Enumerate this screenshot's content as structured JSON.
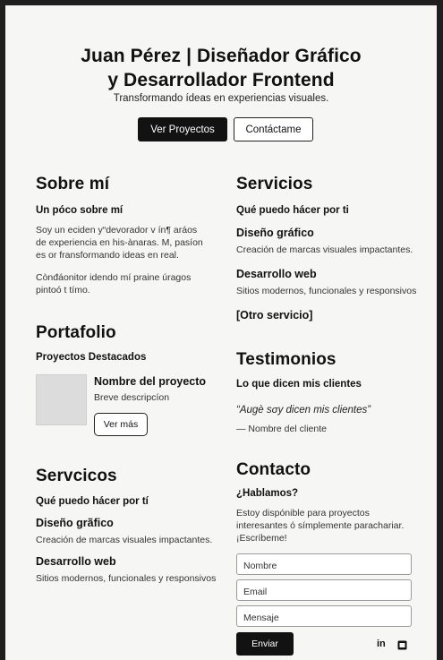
{
  "hero": {
    "title_line1": "Juan Pérez | Diseñador Gráfico",
    "title_line2": "y Desarrollador Frontend",
    "subtitle": "Transformando ídeas en experiencias visuales.",
    "primary_button": "Ver Proyectos",
    "secondary_button": "Contáctame"
  },
  "about": {
    "title": "Sobre mí",
    "subtitle": "Un póco sobre mí",
    "para1_line1": "Soy un eciden y“devorador v ín¶ aráos",
    "para1_line2": "de experiencia en his-ànaras. M, pasíon",
    "para1_line3": "es or fransformando ideas en real.",
    "para2_line1": "Cònđáonitor idendo mí praine úragos",
    "para2_line2": "pintoó t tímo."
  },
  "services_right": {
    "title": "Servicios",
    "subtitle": "Qué puedo hácer por ti",
    "items": [
      {
        "name": "Diseño gráfico",
        "desc": "Creación de marcas visuales impactantes."
      },
      {
        "name": "Desarrollo web",
        "desc": "Sitios modernos, funcionales y responsivos"
      },
      {
        "name": "[Otro servicio]",
        "desc": ""
      }
    ]
  },
  "portfolio": {
    "title": "Portafolio",
    "subtitle": "Proyectos Destacados",
    "project_name": "Nombre del proyecto",
    "project_desc": "Breve descripcíon",
    "button": "Ver más"
  },
  "testimonials": {
    "title": "Testimonios",
    "subtitle": "Lo que dicen mis clientes",
    "quote": "“Augè sσy dicen mis clientes”",
    "author": "— Nombre del cliente"
  },
  "services_left": {
    "title": "Servcicos",
    "subtitle": "Qué puedo hácer por tí",
    "items": [
      {
        "name": "Diseño grãfico",
        "desc": "Creación de marcas visuales impactantes."
      },
      {
        "name": "Desarrollo web",
        "desc": "Sitios modernos, funcionales y responsivos"
      }
    ]
  },
  "contact": {
    "title": "Contacto",
    "subtitle": "¿Hablamos?",
    "text_line1": "Estoy dispónible para proyectos",
    "text_line2": "interesantes ó símplemente parachariar.",
    "text_line3": "¡Escríbeme!",
    "name_placeholder": "Nombre",
    "email_placeholder": "Email",
    "message_placeholder": "Mensaje",
    "send_button": "Enviar",
    "linkedin_label": "in"
  },
  "icons": [
    "linkedin-icon",
    "square-icon"
  ],
  "colors": {
    "page_bg": "#f6f6f4",
    "frame_bg": "#1f1f1f",
    "dark_button": "#121212"
  }
}
